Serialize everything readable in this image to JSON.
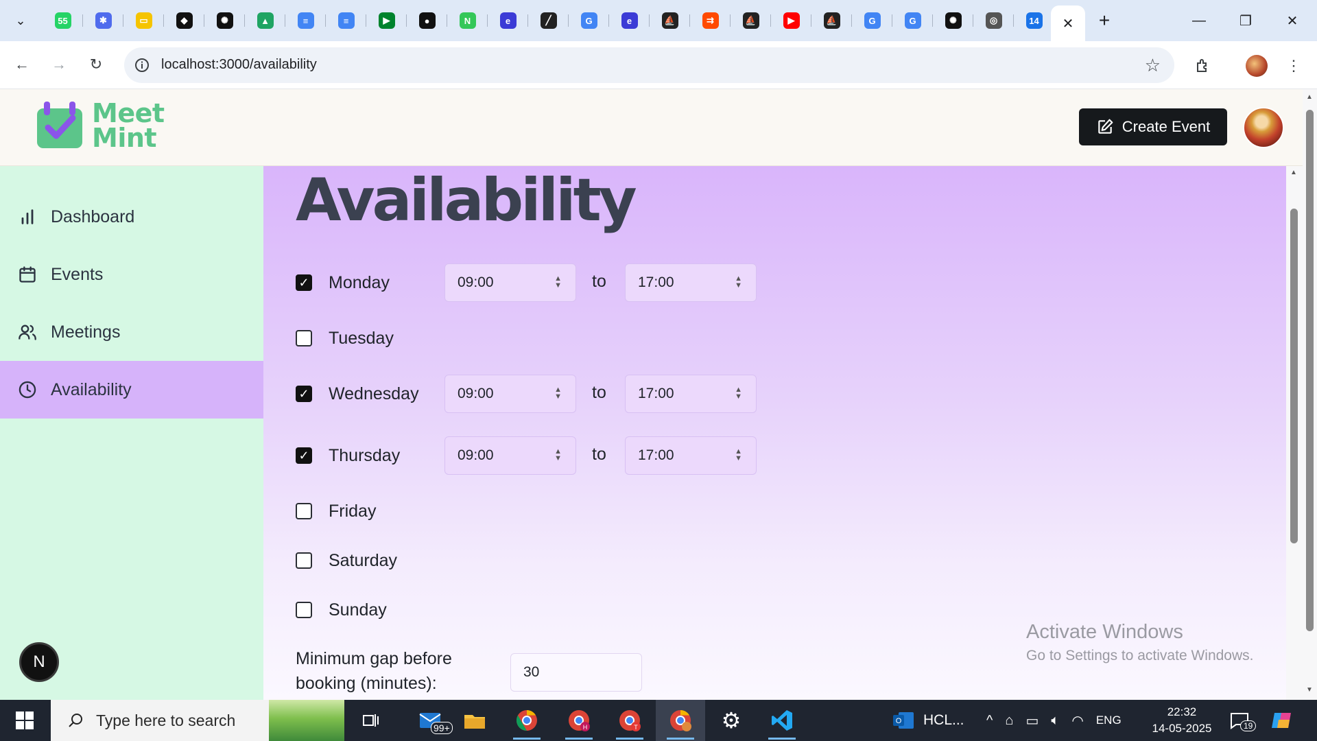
{
  "browser": {
    "url": "localhost:3000/availability",
    "pinned_tabs": [
      {
        "icon": "whatsapp-icon",
        "color": "#25d366",
        "glyph": "55"
      },
      {
        "icon": "copilot-icon",
        "color": "#4f6bed",
        "glyph": "✱"
      },
      {
        "icon": "keep-icon",
        "color": "#f5c400",
        "glyph": "▭"
      },
      {
        "icon": "leaf-icon",
        "color": "#111111",
        "glyph": "◆"
      },
      {
        "icon": "chatgpt-icon",
        "color": "#111111",
        "glyph": "✺"
      },
      {
        "icon": "drive-icon",
        "color": "#1fa463",
        "glyph": "▲"
      },
      {
        "icon": "docs-icon",
        "color": "#4285f4",
        "glyph": "≡"
      },
      {
        "icon": "docs-icon",
        "color": "#4285f4",
        "glyph": "≡"
      },
      {
        "icon": "meet-icon",
        "color": "#00832d",
        "glyph": "▶"
      },
      {
        "icon": "github-icon",
        "color": "#111111",
        "glyph": "●"
      },
      {
        "icon": "notion-icon",
        "color": "#34c759",
        "glyph": "N"
      },
      {
        "icon": "e-icon",
        "color": "#3b3bd6",
        "glyph": "e"
      },
      {
        "icon": "pen-icon",
        "color": "#222222",
        "glyph": "╱"
      },
      {
        "icon": "google-icon",
        "color": "#4285f4",
        "glyph": "G"
      },
      {
        "icon": "e-icon",
        "color": "#3b3bd6",
        "glyph": "e"
      },
      {
        "icon": "sail-icon",
        "color": "#222222",
        "glyph": "⛵"
      },
      {
        "icon": "zapier-icon",
        "color": "#ff4a00",
        "glyph": "⇉"
      },
      {
        "icon": "sail-icon",
        "color": "#222222",
        "glyph": "⛵"
      },
      {
        "icon": "youtube-icon",
        "color": "#ff0000",
        "glyph": "▶"
      },
      {
        "icon": "sail-icon",
        "color": "#222222",
        "glyph": "⛵"
      },
      {
        "icon": "google-icon",
        "color": "#4285f4",
        "glyph": "G"
      },
      {
        "icon": "google-icon",
        "color": "#4285f4",
        "glyph": "G"
      },
      {
        "icon": "chatgpt-icon",
        "color": "#111111",
        "glyph": "✺"
      },
      {
        "icon": "chrome-icon",
        "color": "#555555",
        "glyph": "◎"
      },
      {
        "icon": "calendar-icon",
        "color": "#1a73e8",
        "glyph": "14"
      }
    ]
  },
  "header": {
    "logo_line1": "Meet",
    "logo_line2": "Mint",
    "create_button": "Create Event"
  },
  "sidebar": {
    "items": [
      {
        "label": "Dashboard",
        "icon": "bar-chart-icon"
      },
      {
        "label": "Events",
        "icon": "calendar-icon"
      },
      {
        "label": "Meetings",
        "icon": "users-icon"
      },
      {
        "label": "Availability",
        "icon": "clock-icon"
      }
    ],
    "active": "Availability",
    "fab_letter": "N"
  },
  "main": {
    "title": "Availability",
    "to_label": "to",
    "days": [
      {
        "name": "Monday",
        "checked": true,
        "start": "09:00",
        "end": "17:00"
      },
      {
        "name": "Tuesday",
        "checked": false
      },
      {
        "name": "Wednesday",
        "checked": true,
        "start": "09:00",
        "end": "17:00"
      },
      {
        "name": "Thursday",
        "checked": true,
        "start": "09:00",
        "end": "17:00"
      },
      {
        "name": "Friday",
        "checked": false
      },
      {
        "name": "Saturday",
        "checked": false
      },
      {
        "name": "Sunday",
        "checked": false
      }
    ],
    "gap_label": "Minimum gap before booking (minutes):",
    "gap_value": "30"
  },
  "watermark": {
    "line1": "Activate Windows",
    "line2": "Go to Settings to activate Windows."
  },
  "taskbar": {
    "search_placeholder": "Type here to search",
    "mail_badge": "99+",
    "outlook_label": "HCL...",
    "language": "ENG",
    "time": "22:32",
    "date": "14-05-2025",
    "notification_count": "19"
  },
  "colors": {
    "sidebar_bg": "#d6f8e4",
    "active_nav": "#d6b3fa",
    "brand_green": "#5cc58a",
    "main_gradient_top": "#d9b5fb"
  }
}
